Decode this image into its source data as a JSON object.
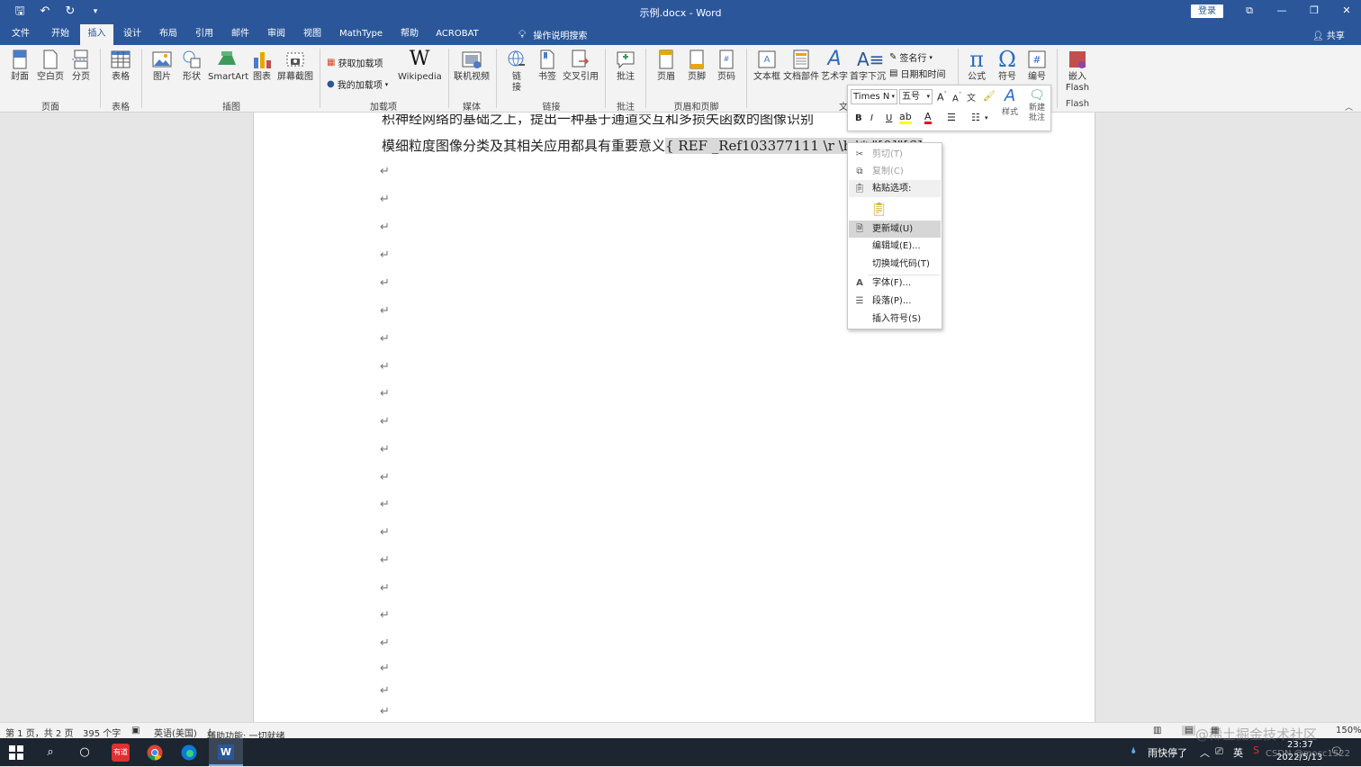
{
  "window": {
    "title": "示例.docx  -  Word",
    "login_label": "登录",
    "controls": [
      "⧉",
      "—",
      "❐",
      "✕"
    ]
  },
  "tabs": [
    "文件",
    "开始",
    "插入",
    "设计",
    "布局",
    "引用",
    "邮件",
    "审阅",
    "视图",
    "MathType",
    "帮助",
    "ACROBAT"
  ],
  "active_tab": "插入",
  "tell_me": "操作说明搜索",
  "share_label": "共享",
  "ribbon": {
    "buttons": {
      "cover": "封面",
      "blank": "空白页",
      "pagebreak": "分页",
      "table": "表格",
      "picture": "图片",
      "shapes": "形状",
      "smartart": "SmartArt",
      "chart": "图表",
      "screenshot": "屏幕截图",
      "get_addins": "获取加载项",
      "my_addins": "我的加载项",
      "wikipedia": "Wikipedia",
      "online_video": "联机视频",
      "link": "链接",
      "bookmark": "书签",
      "crossref": "交叉引用",
      "comment": "批注",
      "header": "页眉",
      "footer": "页脚",
      "pagenum": "页码",
      "textbox": "文本框",
      "quickparts": "文档部件",
      "wordart": "艺术字",
      "dropcap": "首字下沉",
      "signature": "签名行",
      "datetime": "日期和时间",
      "equation": "公式",
      "symbol": "符号",
      "number": "编号",
      "flash": "嵌入Flash"
    },
    "groups": {
      "pages": "页面",
      "tables": "表格",
      "illustrations": "插图",
      "addins": "加载项",
      "media": "媒体",
      "links": "链接",
      "comments": "批注",
      "headerfooter": "页眉和页脚",
      "text": "文",
      "flash": "Flash"
    }
  },
  "document": {
    "line1": "积神经网络的基础之上，提出一种基于通道交互和多损失函数的图像识别",
    "line2_text": "模细粒度图像分类及其相关应用都具有重要意义",
    "line2_field": "{ REF _Ref103377111 \\r \\h \\* \"[0]\"[6]",
    "para_mark": "↵"
  },
  "mini_toolbar": {
    "font": "Times N",
    "size": "五号",
    "styles_label": "样式",
    "new_comment_label": "新建批注",
    "bold": "B",
    "italic": "I",
    "underline": "U"
  },
  "context_menu": {
    "cut": "剪切(T)",
    "copy": "复制(C)",
    "paste_options": "粘贴选项:",
    "update_field": "更新域(U)",
    "edit_field": "编辑域(E)...",
    "toggle_codes": "切换域代码(T)",
    "font": "字体(F)...",
    "paragraph": "段落(P)...",
    "insert_symbol": "插入符号(S)"
  },
  "status": {
    "page": "第 1 页，共 2 页",
    "words": "395 个字",
    "language": "英语(美国)",
    "accessibility": "辅助功能: 一切就绪",
    "zoom": "150%"
  },
  "taskbar": {
    "weather": "雨快停了",
    "ime": "英",
    "time": "23:37",
    "date": "2022/5/13",
    "youdao": "有道"
  },
  "watermarks": {
    "juejin": "@稀土掘金技术社区",
    "csdn": "CSDN @mocc1522"
  }
}
